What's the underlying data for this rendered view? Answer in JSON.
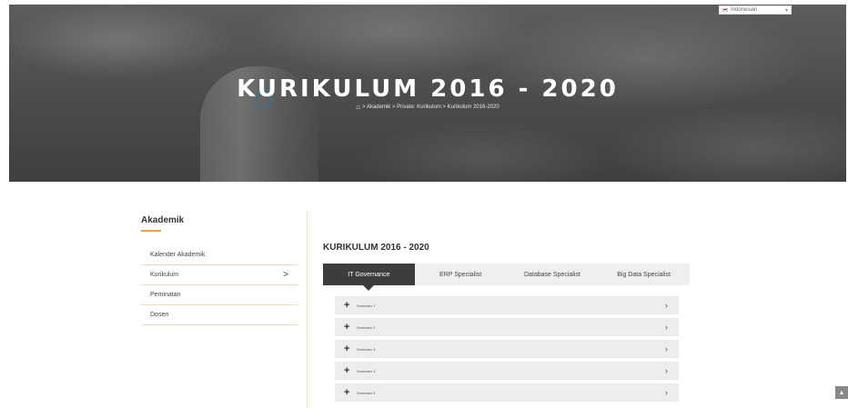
{
  "language": {
    "selected": "Indonesian"
  },
  "hero": {
    "title": "KURIKULUM 2016 - 2020",
    "breadcrumb": "> Akademik > Private: Kurikulum > Kurikulum 2016-2020"
  },
  "sidebar": {
    "title": "Akademik",
    "items": [
      {
        "label": "Kalender Akademik"
      },
      {
        "label": "Kurikulum",
        "arrow": ">"
      },
      {
        "label": "Peminatan"
      },
      {
        "label": "Dosen"
      }
    ]
  },
  "main": {
    "title": "KURIKULUM 2016 - 2020",
    "tabs": [
      {
        "label": "IT Governance",
        "active": true
      },
      {
        "label": "ERP Specialist"
      },
      {
        "label": "Database Specialist"
      },
      {
        "label": "Big Data Specialist"
      }
    ],
    "semesters": [
      {
        "label": "Semester 1"
      },
      {
        "label": "Semester 2"
      },
      {
        "label": "Semester 3"
      },
      {
        "label": "Semester 4"
      },
      {
        "label": "Semester 5"
      }
    ]
  },
  "colors": {
    "accent": "#e7a33e",
    "tab_active": "#3d3d3d"
  },
  "icons": {
    "home": "home-icon",
    "scroll_top": "chevron-up-icon",
    "expand": "plus-icon",
    "row_chevron": "chevron-right-icon"
  }
}
